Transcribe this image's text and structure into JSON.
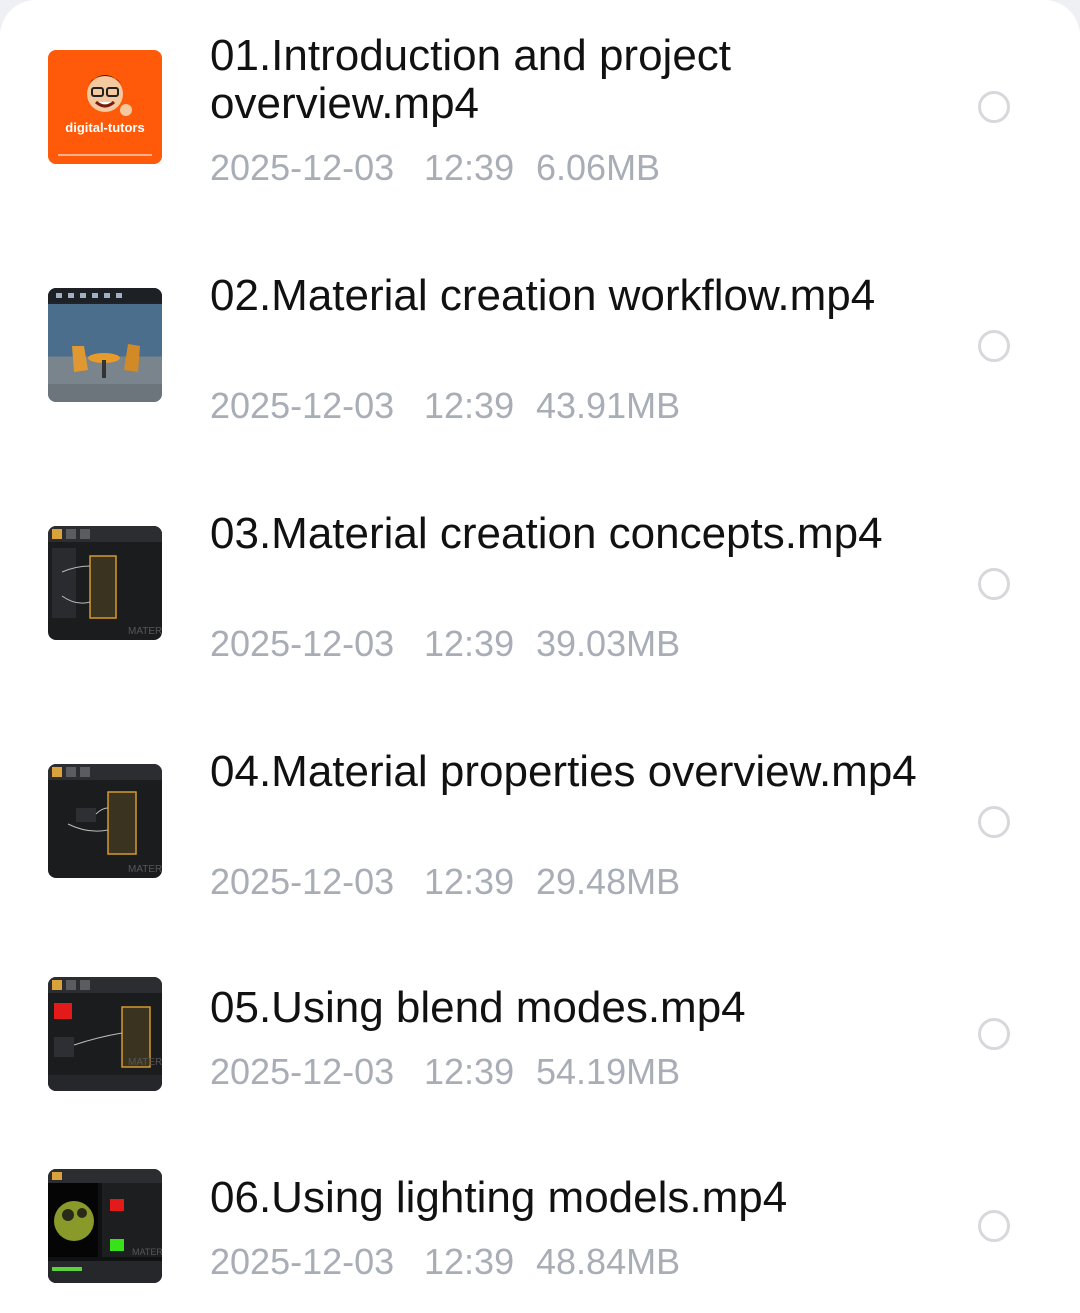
{
  "files": [
    {
      "name": "01.Introduction and project overview.mp4",
      "date": "2025-12-03",
      "time": "12:39",
      "size": "6.06MB",
      "thumb": "orange-logo"
    },
    {
      "name": "02.Material creation workflow.mp4",
      "date": "2025-12-03",
      "time": "12:39",
      "size": "43.91MB",
      "thumb": "3d-scene"
    },
    {
      "name": "03.Material creation concepts.mp4",
      "date": "2025-12-03",
      "time": "12:39",
      "size": "39.03MB",
      "thumb": "node-editor"
    },
    {
      "name": "04.Material properties overview.mp4",
      "date": "2025-12-03",
      "time": "12:39",
      "size": "29.48MB",
      "thumb": "node-editor"
    },
    {
      "name": "05.Using blend modes.mp4",
      "date": "2025-12-03",
      "time": "12:39",
      "size": "54.19MB",
      "thumb": "node-editor-red"
    },
    {
      "name": "06.Using lighting models.mp4",
      "date": "2025-12-03",
      "time": "12:39",
      "size": "48.84MB",
      "thumb": "editor-green-character"
    }
  ],
  "thumbnail_logo_text": "digital-tutors",
  "thumbnail_watermark": "MATERI"
}
